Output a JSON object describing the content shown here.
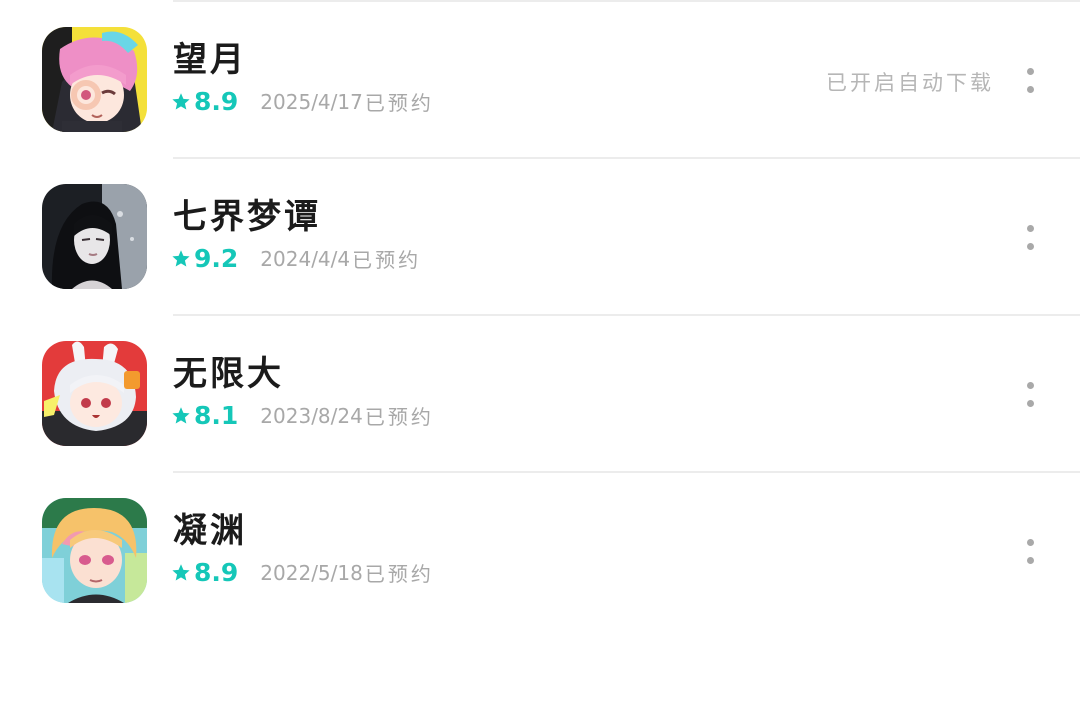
{
  "games": [
    {
      "name": "望月",
      "rating": "8.9",
      "date": "2025/4/17",
      "status": "已预约",
      "auto_download": "已开启自动下载",
      "icon": "anime-girl-pink-hair-icon"
    },
    {
      "name": "七界梦谭",
      "rating": "9.2",
      "date": "2024/4/4",
      "status": "已预约",
      "icon": "dark-haired-woman-icon"
    },
    {
      "name": "无限大",
      "rating": "8.1",
      "date": "2023/8/24",
      "status": "已预约",
      "icon": "white-haired-bunny-girl-icon"
    },
    {
      "name": "凝渊",
      "rating": "8.9",
      "date": "2022/5/18",
      "status": "已预约",
      "icon": "blonde-anime-boy-icon"
    }
  ],
  "colors": {
    "rating": "#15c7b8",
    "secondary_text": "#a8a8a8",
    "title_text": "#1b1b1b",
    "divider": "#ececec",
    "more_dots": "#a9a9a9"
  }
}
